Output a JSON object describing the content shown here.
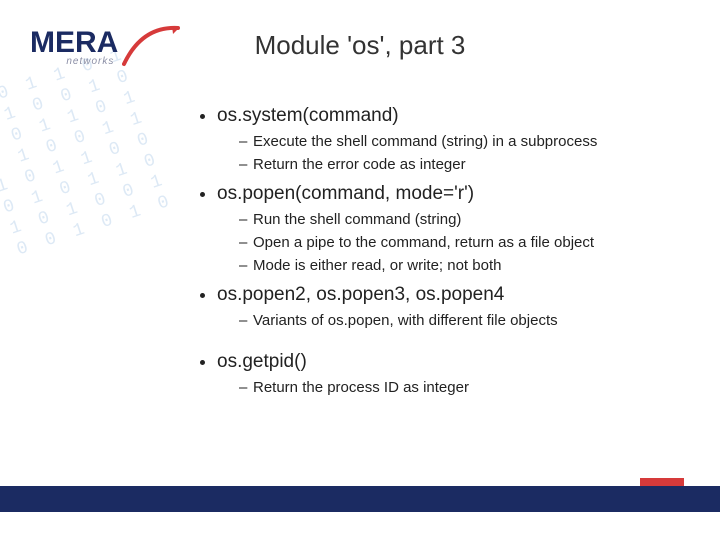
{
  "logo": {
    "main": "MERA",
    "sub": "networks"
  },
  "title": "Module 'os', part 3",
  "bg_binary": "0 1 0 0 1 1 0 1\n1 0 1 1 0 0 1 0\n0 0 1 0 1 1 0 1\n1 1 0 1 0 0 1 1\n0 1 1 0 1 1 0 0\n1 0 0 1 0 1 1 0\n0 1 1 0 1 0 0 1\n1 1 0 0 1 0 1 0",
  "items": [
    {
      "head": "os.system(command)",
      "sub": [
        "Execute the shell command (string) in a subprocess",
        "Return the error code as integer"
      ]
    },
    {
      "head": "os.popen(command, mode='r')",
      "sub": [
        "Run the shell command (string)",
        "Open a pipe to the command, return as a file object",
        "Mode is either read, or write; not both"
      ]
    },
    {
      "head": "os.popen2, os.popen3, os.popen4",
      "sub": [
        "Variants of os.popen, with different file objects"
      ]
    },
    {
      "head": "os.getpid()",
      "sub": [
        "Return the process ID as integer"
      ],
      "gap_before": true
    }
  ]
}
